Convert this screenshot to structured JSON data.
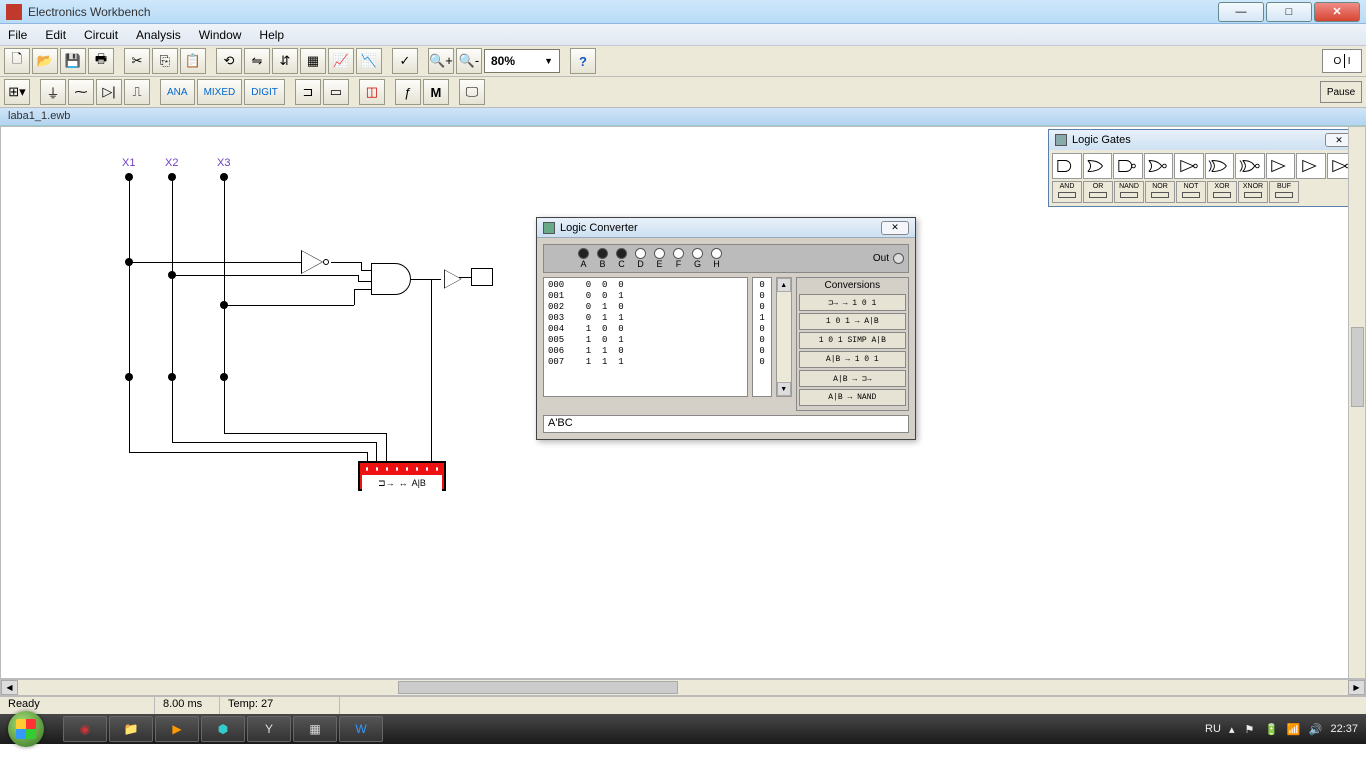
{
  "window": {
    "title": "Electronics Workbench",
    "bg_title": ""
  },
  "menubar": {
    "file": "File",
    "edit": "Edit",
    "circuit": "Circuit",
    "analysis": "Analysis",
    "window": "Window",
    "help": "Help"
  },
  "toolbar1": {
    "zoom_value": "80%",
    "help_label": "?"
  },
  "toolbar2": {
    "ana": "ANA",
    "mixed": "MIXED",
    "digit": "DIGIT",
    "pause": "Pause",
    "sw_on": "O",
    "sw_off": "I"
  },
  "document": {
    "name": "laba1_1.ewb"
  },
  "schematic": {
    "labels": {
      "x1": "X1",
      "x2": "X2",
      "x3": "X3"
    },
    "device_label": "A|B"
  },
  "logic_converter": {
    "title": "Logic Converter",
    "terminals": [
      "A",
      "B",
      "C",
      "D",
      "E",
      "F",
      "G",
      "H"
    ],
    "active_terms": [
      true,
      true,
      true,
      false,
      false,
      false,
      false,
      false
    ],
    "out_label": "Out",
    "rows": [
      {
        "idx": "000",
        "a": "0",
        "b": "0",
        "c": "0",
        "out": "0"
      },
      {
        "idx": "001",
        "a": "0",
        "b": "0",
        "c": "1",
        "out": "0"
      },
      {
        "idx": "002",
        "a": "0",
        "b": "1",
        "c": "0",
        "out": "0"
      },
      {
        "idx": "003",
        "a": "0",
        "b": "1",
        "c": "1",
        "out": "1"
      },
      {
        "idx": "004",
        "a": "1",
        "b": "0",
        "c": "0",
        "out": "0"
      },
      {
        "idx": "005",
        "a": "1",
        "b": "0",
        "c": "1",
        "out": "0"
      },
      {
        "idx": "006",
        "a": "1",
        "b": "1",
        "c": "0",
        "out": "0"
      },
      {
        "idx": "007",
        "a": "1",
        "b": "1",
        "c": "1",
        "out": "0"
      }
    ],
    "conversions_title": "Conversions",
    "btns": [
      "⊐→   →   1 0 1",
      "1 0 1   →   A|B",
      "1 0 1  SIMP  A|B",
      "A|B   →   1 0 1",
      "A|B   →   ⊐→",
      "A|B   →   NAND"
    ],
    "expression": "A'BC"
  },
  "logic_gates": {
    "title": "Logic Gates",
    "row2": [
      "AND",
      "OR",
      "NAND",
      "NOR",
      "NOT",
      "XOR",
      "XNOR",
      "BUF"
    ]
  },
  "statusbar": {
    "ready": "Ready",
    "time": "8.00 ms",
    "temp": "Temp: 27"
  },
  "taskbar": {
    "lang": "RU",
    "clock": "22:37"
  }
}
